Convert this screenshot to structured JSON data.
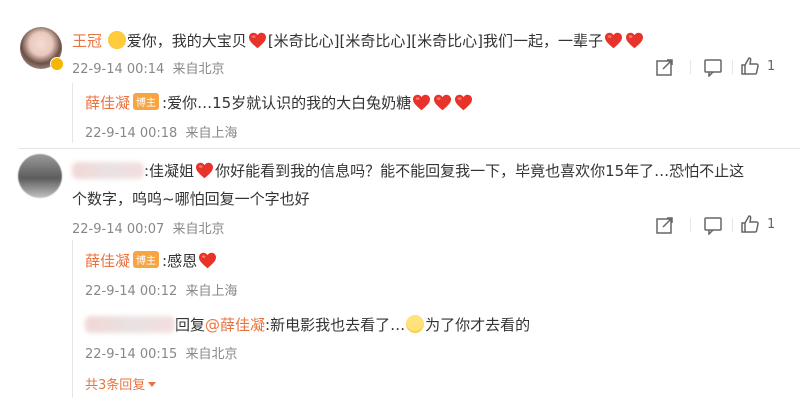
{
  "comment1": {
    "author": "王冠",
    "text_a": "爱你，我的大宝贝",
    "tag": "[米奇比心]",
    "text_b": "我们一起，一辈子",
    "time": "22-9-14 00:14",
    "location": "来自北京",
    "like_count": "1",
    "reply": {
      "author": "薛佳凝",
      "badge": "博主",
      "text": ":爱你…15岁就认识的我的大白兔奶糖",
      "time": "22-9-14 00:18",
      "location": "来自上海"
    }
  },
  "comment2": {
    "text_a": ":佳凝姐",
    "text_b": "你好能看到我的信息吗？能不能回复我一下，毕竟也喜欢你15年了…恐怕不止这",
    "text_c": "个数字，呜呜~哪怕回复一个字也好",
    "time": "22-9-14 00:07",
    "location": "来自北京",
    "like_count": "1",
    "reply1": {
      "author": "薛佳凝",
      "badge": "博主",
      "text": ":感恩",
      "time": "22-9-14 00:12",
      "location": "来自上海"
    },
    "reply2": {
      "prefix": "回复",
      "mention": "@薛佳凝",
      "text_a": ":新电影我也去看了…",
      "text_b": "为了你才去看的",
      "time": "22-9-14 00:15",
      "location": "来自北京"
    },
    "more_replies": "共3条回复"
  },
  "colors": {
    "name": "#eb7340",
    "badge": "#f7a442",
    "heart": "#e8332a",
    "meta": "#888888"
  },
  "icons": [
    "share-icon",
    "comment-icon",
    "like-icon",
    "heart-emoji",
    "grin-emoji",
    "verified-badge-icon"
  ]
}
